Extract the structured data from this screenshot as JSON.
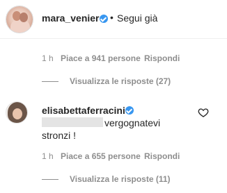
{
  "header": {
    "username": "mara_venier",
    "separator": "•",
    "follow_label": "Segui già"
  },
  "first_comment": {
    "time": "1 h",
    "likes": "Piace a 941 persone",
    "reply": "Rispondi",
    "view_replies": "Visualizza le risposte (27)"
  },
  "second_comment": {
    "username": "elisabettaferracini",
    "text_line1": "vergognatevi",
    "text_line2": "stronzi !",
    "time": "1 h",
    "likes": "Piace a 655 persone",
    "reply": "Rispondi",
    "view_replies": "Visualizza le risposte (11)"
  },
  "colors": {
    "verified": "#3897f0",
    "meta_text": "#8e8e8e",
    "primary_text": "#262626"
  },
  "icons": {
    "verified": "verified-badge-icon",
    "like": "heart-outline-icon"
  }
}
